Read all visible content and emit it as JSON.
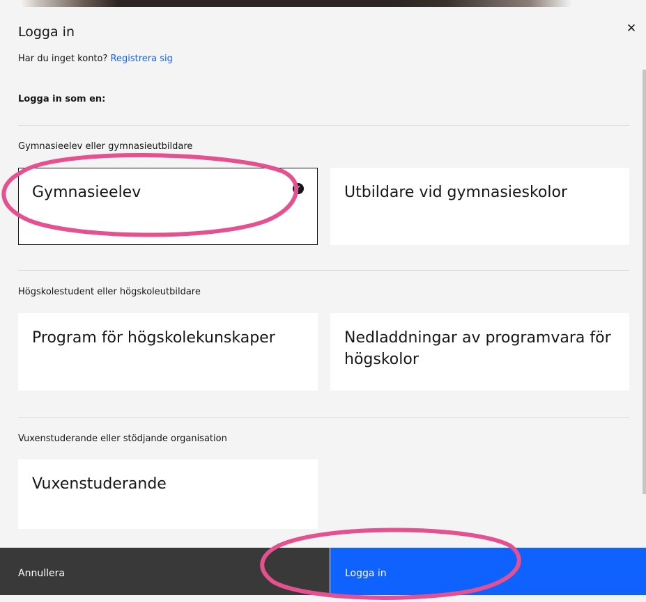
{
  "dialog": {
    "title": "Logga in",
    "register_prompt": "Har du inget konto?",
    "register_link": "Registrera sig",
    "signin_as": "Logga in som en:"
  },
  "sections": [
    {
      "label": "Gymnasieelev eller gymnasieutbildare",
      "tiles": [
        {
          "label": "Gymnasieelev",
          "selected": true
        },
        {
          "label": "Utbildare vid gymnasieskolor",
          "selected": false
        }
      ]
    },
    {
      "label": "Högskolestudent eller högskoleutbildare",
      "tiles": [
        {
          "label": "Program för högskolekunskaper",
          "selected": false
        },
        {
          "label": "Nedladdningar av programvara för högskolor",
          "selected": false
        }
      ]
    },
    {
      "label": "Vuxenstuderande eller stödjande organisation",
      "tiles": [
        {
          "label": "Vuxenstuderande",
          "selected": false
        }
      ]
    }
  ],
  "footer": {
    "cancel_label": "Annullera",
    "login_label": "Logga in"
  },
  "icons": {
    "close": "close-icon",
    "selected_check": "checkmark-icon"
  },
  "colors": {
    "link": "#0f62fe",
    "primary_button": "#0f62fe",
    "secondary_button": "#393939",
    "annotation": "#e5508f"
  }
}
